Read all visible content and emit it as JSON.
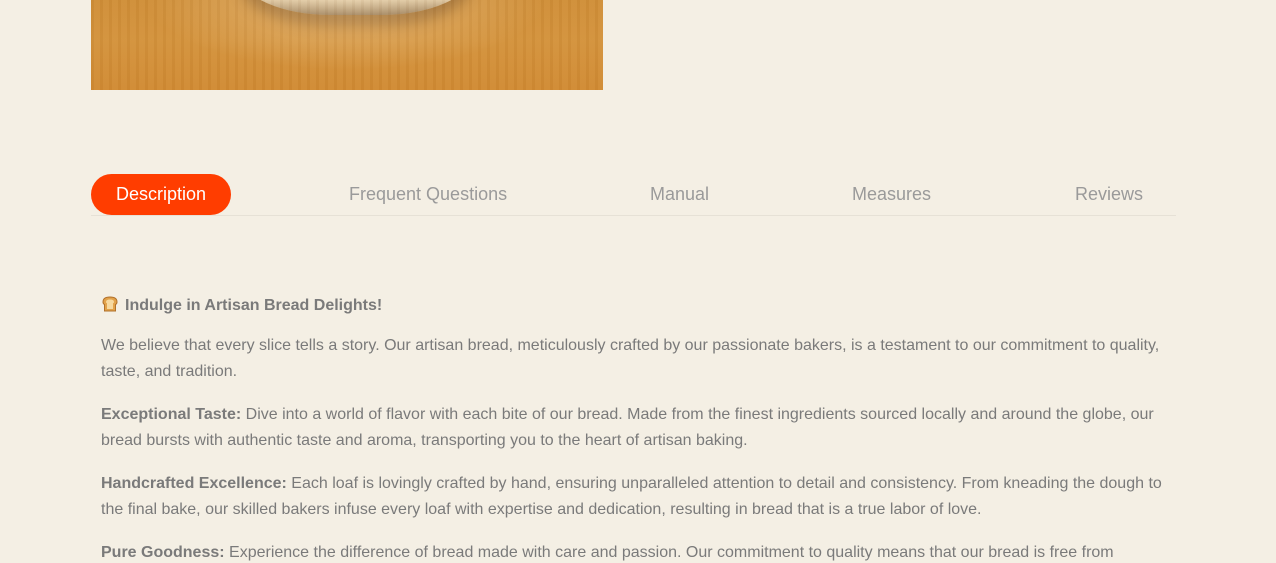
{
  "product": {
    "image_alt": "artisan bread loaf on wooden table"
  },
  "tabs": [
    {
      "label": "Description",
      "active": true
    },
    {
      "label": "Frequent Questions",
      "active": false
    },
    {
      "label": "Manual",
      "active": false
    },
    {
      "label": "Measures",
      "active": false
    },
    {
      "label": "Reviews",
      "active": false
    }
  ],
  "description": {
    "heading_icon": "bread-icon",
    "heading": "Indulge in Artisan Bread Delights!",
    "intro": "We believe that every slice tells a story. Our artisan bread, meticulously crafted by our passionate bakers, is a testament to our commitment to quality, taste, and tradition.",
    "features": [
      {
        "title": "Exceptional Taste:",
        "text": " Dive into a world of flavor with each bite of our bread. Made from the finest ingredients sourced locally and around the globe, our bread bursts with authentic taste and aroma, transporting you to the heart of artisan baking."
      },
      {
        "title": "Handcrafted Excellence:",
        "text": " Each loaf is lovingly crafted by hand, ensuring unparalleled attention to detail and consistency. From kneading the dough to the final bake, our skilled bakers infuse every loaf with expertise and dedication, resulting in bread that is a true labor of love."
      },
      {
        "title": "Pure Goodness:",
        "text": " Experience the difference of bread made with care and passion. Our commitment to quality means that our bread is free from"
      }
    ]
  },
  "colors": {
    "background": "#f4efe4",
    "accent": "#ff3d00",
    "text": "#7a7a7a",
    "tab_inactive": "#9a9a9a"
  }
}
